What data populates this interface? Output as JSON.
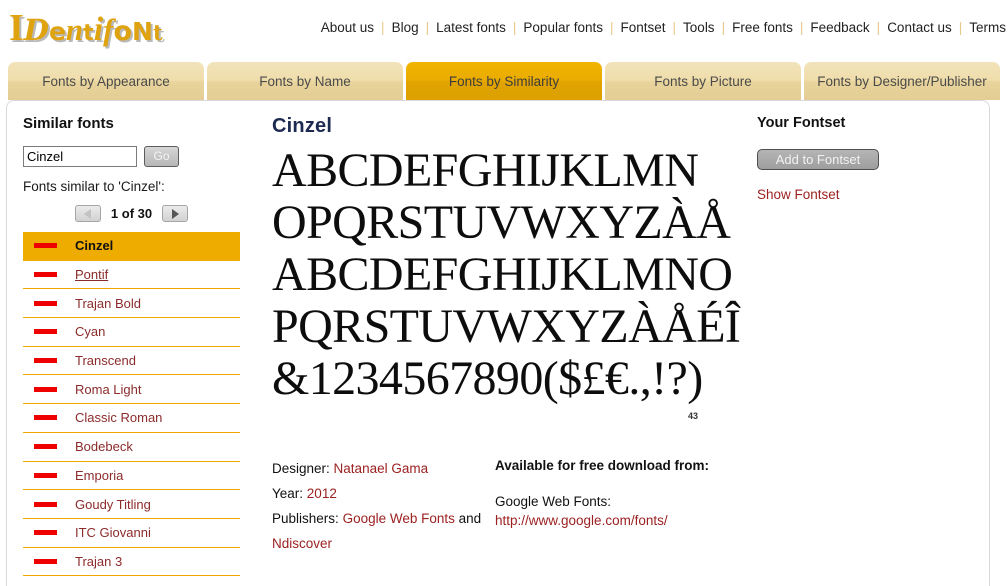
{
  "brand": {
    "logo_parts": [
      "I",
      "D",
      "e",
      "n",
      "t",
      "i",
      "f",
      "o",
      "N",
      "t"
    ],
    "logo_text": "IDentifoNt",
    "logo_color": "#E0A310"
  },
  "topnav": {
    "items": [
      {
        "label": "About us"
      },
      {
        "label": "Blog"
      },
      {
        "label": "Latest fonts"
      },
      {
        "label": "Popular fonts"
      },
      {
        "label": "Fontset"
      },
      {
        "label": "Tools"
      },
      {
        "label": "Free fonts"
      },
      {
        "label": "Feedback"
      },
      {
        "label": "Contact us"
      },
      {
        "label": "Terms"
      }
    ]
  },
  "tabs": [
    {
      "label": "Fonts by Appearance",
      "active": false
    },
    {
      "label": "Fonts by Name",
      "active": false
    },
    {
      "label": "Fonts by Similarity",
      "active": true
    },
    {
      "label": "Fonts by Picture",
      "active": false
    },
    {
      "label": "Fonts by Designer/Publisher",
      "active": false
    }
  ],
  "sidebar": {
    "heading": "Similar fonts",
    "search_value": "Cinzel",
    "search_placeholder": "",
    "go_label": "Go",
    "similar_label": "Fonts similar to 'Cinzel':",
    "pager_label": "1 of 30",
    "pager_current": 1,
    "pager_total": 30,
    "fonts": [
      {
        "name": "Cinzel",
        "selected": true,
        "hovered": false
      },
      {
        "name": "Pontif",
        "selected": false,
        "hovered": true
      },
      {
        "name": "Trajan Bold",
        "selected": false,
        "hovered": false
      },
      {
        "name": "Cyan",
        "selected": false,
        "hovered": false
      },
      {
        "name": "Transcend",
        "selected": false,
        "hovered": false
      },
      {
        "name": "Roma Light",
        "selected": false,
        "hovered": false
      },
      {
        "name": "Classic Roman",
        "selected": false,
        "hovered": false
      },
      {
        "name": "Bodebeck",
        "selected": false,
        "hovered": false
      },
      {
        "name": "Emporia",
        "selected": false,
        "hovered": false
      },
      {
        "name": "Goudy Titling",
        "selected": false,
        "hovered": false
      },
      {
        "name": "ITC Giovanni",
        "selected": false,
        "hovered": false
      },
      {
        "name": "Trajan 3",
        "selected": false,
        "hovered": false
      }
    ],
    "accent_color": "#eeac00",
    "dash_color": "#ee0000"
  },
  "main": {
    "font_title": "Cinzel",
    "specimen_lines": [
      "ABCDEFGHIJKLMN",
      "OPQRSTUVWXYZÀÅ",
      "ABCDEFGHIJKLMNO",
      "PQRSTUVWXYZÀÅÉÎ",
      "&1234567890($£€.,!?)"
    ],
    "specimen_number": "43",
    "meta": {
      "designer_label": "Designer:",
      "designer_value": "Natanael Gama",
      "year_label": "Year:",
      "year_value": "2012",
      "publishers_label": "Publishers:",
      "publisher_1": "Google Web Fonts",
      "publishers_conjunction": "and",
      "publisher_2": "Ndiscover"
    },
    "download": {
      "heading": "Available for free download from:",
      "source_label": "Google Web Fonts:",
      "source_url": "http://www.google.com/fonts/"
    }
  },
  "fontset": {
    "heading": "Your Fontset",
    "add_label": "Add to Fontset",
    "show_label": "Show Fontset"
  }
}
